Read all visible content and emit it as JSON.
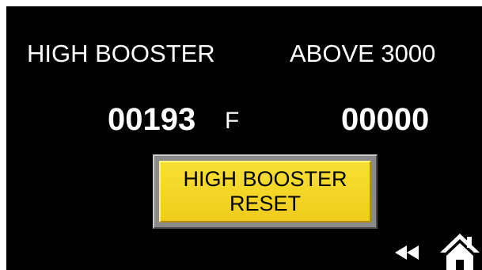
{
  "header": {
    "left_title": "HIGH BOOSTER",
    "right_title": "ABOVE 3000"
  },
  "readings": {
    "left_value": "00193",
    "left_unit": "F",
    "right_value": "00000"
  },
  "reset_button": {
    "line1": "HIGH BOOSTER",
    "line2": "RESET"
  },
  "nav": {
    "back_icon": "double-left-arrow-icon",
    "home_icon": "home-icon"
  },
  "colors": {
    "background": "#000000",
    "text": "#ffffff",
    "button_face": "#f2d423",
    "button_text": "#000000"
  }
}
